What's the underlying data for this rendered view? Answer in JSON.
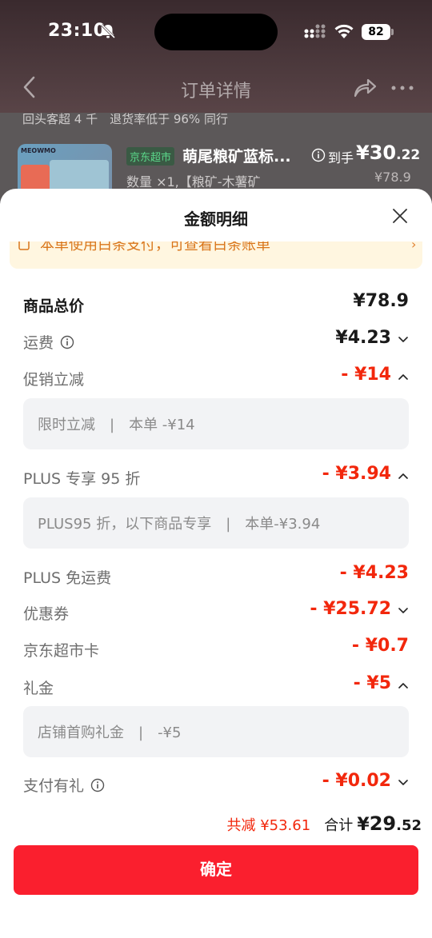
{
  "status_bar": {
    "time": "23:10",
    "battery": "82"
  },
  "navbar": {
    "title": "订单详情"
  },
  "background": {
    "store_info": "回头客超 4 千　退货率低于 96% 同行",
    "thumb_brand": "MEOWMO",
    "jd_tag": "京东超市",
    "product_title": "萌尾粮矿蓝标...",
    "price_label": "到手",
    "price_currency": "¥",
    "price_int": "30",
    "price_dec": ".22",
    "quantity": "数量 ×1,【粮矿-木薯矿",
    "original_price": "¥78.9"
  },
  "sheet": {
    "title": "金额明细",
    "banner_text": "本单使用白条支付，可查看白条账单",
    "rows": [
      {
        "label": "商品总价",
        "value": "¥78.9"
      },
      {
        "label": "运费",
        "value": "¥4.23"
      },
      {
        "label": "促销立减",
        "value": "- ¥14"
      },
      {
        "label": "PLUS 专享 95 折",
        "value": "- ¥3.94"
      },
      {
        "label": "PLUS 免运费",
        "value": "- ¥4.23"
      },
      {
        "label": "优惠券",
        "value": "- ¥25.72"
      },
      {
        "label": "京东超市卡",
        "value": "- ¥0.7"
      },
      {
        "label": "礼金",
        "value": "- ¥5"
      },
      {
        "label": "支付有礼",
        "value": "- ¥0.02"
      }
    ],
    "details": {
      "promo": "限时立减　|　本单 -¥14",
      "plus": "PLUS95 折，以下商品专享　|　本单-¥3.94",
      "gift": "店铺首购礼金　|　-¥5"
    },
    "footer": {
      "reduce_text": "共减 ¥53.61",
      "total_label": "合计",
      "total_currency": "¥",
      "total_int": "29",
      "total_dec": ".52"
    },
    "confirm_label": "确定"
  },
  "colors": {
    "accent_red": "#f2270c",
    "button_red": "#fa1f2e",
    "banner_bg": "#fff6e0",
    "banner_text": "#d9751a"
  }
}
